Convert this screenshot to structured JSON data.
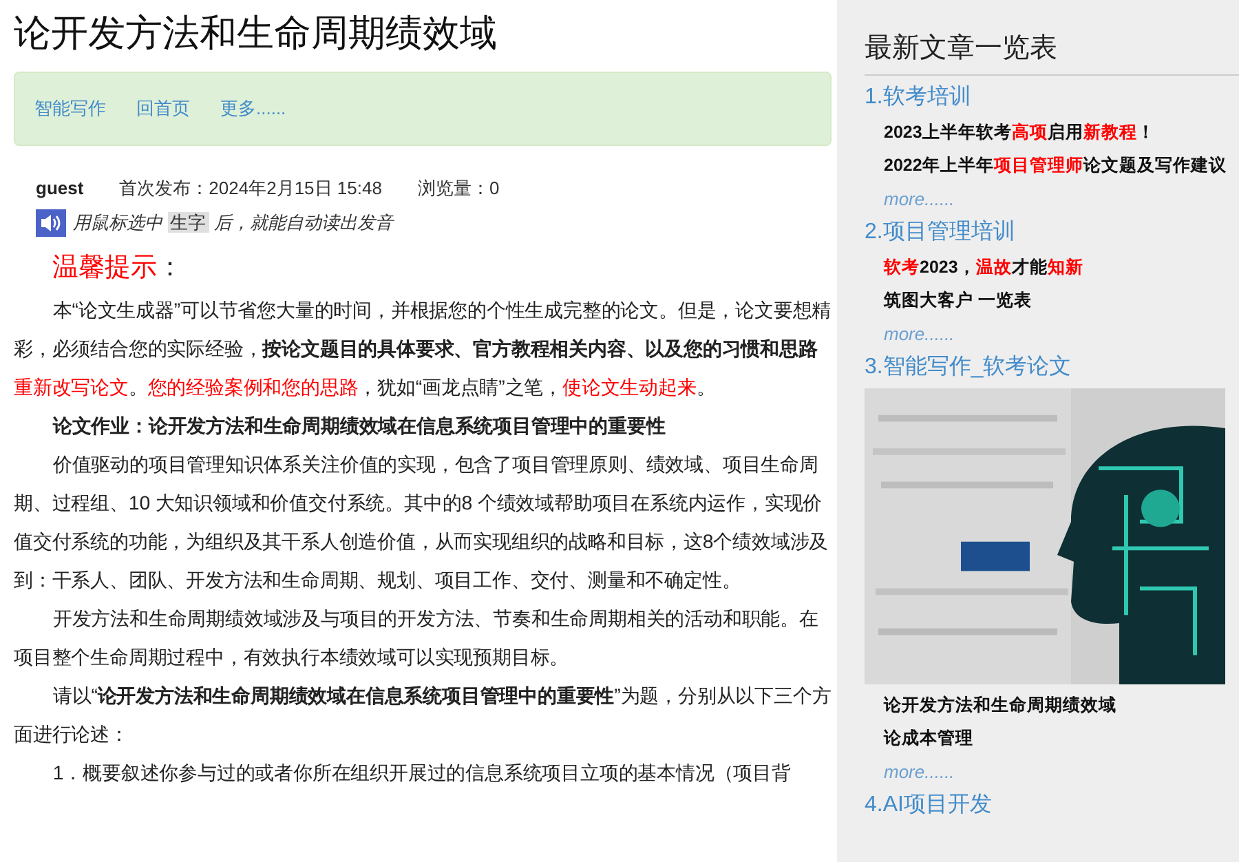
{
  "title": "论开发方法和生命周期绩效域",
  "nav": [
    "智能写作",
    "回首页",
    "更多......"
  ],
  "meta": {
    "author": "guest",
    "published": "首次发布：2024年2月15日 15:48",
    "views": "浏览量：0"
  },
  "read_hint": {
    "before": "用鼠标选中",
    "highlight": "生字",
    "after": "后，就能自动读出发音"
  },
  "tip": {
    "label": "温馨提示",
    "colon": "："
  },
  "article": [
    {
      "kind": "paragraph",
      "segments": [
        {
          "kind": "plain",
          "text": "本“论文生成器”可以节省您大量的时间，并根据您的个性生成完整的论文。但是，论文要想精彩，必须结合您的实际经验，"
        },
        {
          "kind": "bold",
          "text": "按论文题目的具体要求、官方教程相关内容、以及您的习惯和思路"
        },
        {
          "kind": "red",
          "text": "重新改写论文"
        },
        {
          "kind": "plain",
          "text": "。"
        },
        {
          "kind": "red",
          "text": "您的经验案例和您的思路"
        },
        {
          "kind": "plain",
          "text": "，犹如“画龙点睛”之笔，"
        },
        {
          "kind": "red",
          "text": "使论文生动起来"
        },
        {
          "kind": "plain",
          "text": "。"
        }
      ]
    },
    {
      "kind": "heading",
      "segments": [
        {
          "kind": "bold",
          "text": "论文作业：论开发方法和生命周期绩效域在信息系统项目管理中的重要性"
        }
      ]
    },
    {
      "kind": "paragraph",
      "segments": [
        {
          "kind": "plain",
          "text": "价值驱动的项目管理知识体系关注价值的实现，包含了项目管理原则、绩效域、项目生命周期、过程组、10 大知识领域和价值交付系统。其中的8 个绩效域帮助项目在系统内运作，实现价值交付系统的功能，为组织及其干系人创造价值，从而实现组织的战略和目标，这8个绩效域涉及到：干系人、团队、开发方法和生命周期、规划、项目工作、交付、测量和不确定性。"
        }
      ]
    },
    {
      "kind": "paragraph",
      "segments": [
        {
          "kind": "plain",
          "text": "开发方法和生命周期绩效域涉及与项目的开发方法、节奏和生命周期相关的活动和职能。在项目整个生命周期过程中，有效执行本绩效域可以实现预期目标。"
        }
      ]
    },
    {
      "kind": "paragraph",
      "segments": [
        {
          "kind": "plain",
          "text": "请以“"
        },
        {
          "kind": "bold",
          "text": "论开发方法和生命周期绩效域在信息系统项目管理中的重要性"
        },
        {
          "kind": "plain",
          "text": "”为题，分别从以下三个方面进行论述："
        }
      ]
    },
    {
      "kind": "paragraph",
      "segments": [
        {
          "kind": "plain",
          "text": "1．概要叙述你参与过的或者你所在组织开展过的信息系统项目立项的基本情况（项目背"
        }
      ]
    }
  ],
  "sidebar": {
    "title": "最新文章一览表",
    "sections": [
      {
        "heading": "1.软考培训",
        "items": [
          [
            {
              "kind": "bold",
              "text": "2023上半年软考"
            },
            {
              "kind": "red",
              "text": "高项"
            },
            {
              "kind": "bold",
              "text": "启用"
            },
            {
              "kind": "red",
              "text": "新教程"
            },
            {
              "kind": "bold",
              "text": "！"
            }
          ],
          [
            {
              "kind": "bold",
              "text": "2022年上半年"
            },
            {
              "kind": "red",
              "text": "项目管理师"
            },
            {
              "kind": "bold",
              "text": "论文题及写作建议"
            }
          ]
        ],
        "more": "more......"
      },
      {
        "heading": "2.项目管理培训",
        "items": [
          [
            {
              "kind": "red",
              "text": "软考"
            },
            {
              "kind": "bold",
              "text": "2023，"
            },
            {
              "kind": "red",
              "text": "温故"
            },
            {
              "kind": "bold",
              "text": "才能"
            },
            {
              "kind": "red",
              "text": "知新"
            }
          ],
          [
            {
              "kind": "bold",
              "text": "筑图大客户 一览表"
            }
          ]
        ],
        "more": "more......"
      },
      {
        "heading": "3.智能写作_软考论文",
        "picture": true,
        "items": [
          [
            {
              "kind": "bold",
              "text": "论开发方法和生命周期绩效域"
            }
          ],
          [
            {
              "kind": "bold",
              "text": "论成本管理"
            }
          ]
        ],
        "more": "more......"
      },
      {
        "heading": "4.AI项目开发"
      }
    ]
  }
}
